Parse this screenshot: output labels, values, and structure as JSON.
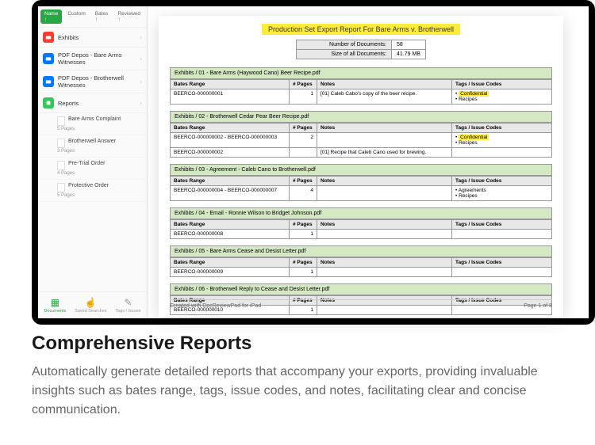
{
  "tabs": {
    "t0": "Name ↑",
    "t1": "Custom",
    "t2": "Bates ↑",
    "t3": "Reviewed ↑"
  },
  "nav": {
    "exhibits": "Exhibits",
    "depos": "PDF Depos - Bare Arms Witnesses",
    "depos2": "PDF Depos - Brotherwell Witnesses",
    "reports": "Reports"
  },
  "subs": {
    "s0": {
      "t": "Bare Arms Complaint",
      "p": "5 Pages"
    },
    "s1": {
      "t": "Brotherwell Answer",
      "p": "3 Pages"
    },
    "s2": {
      "t": "Pre-Trial Order",
      "p": "4 Pages"
    },
    "s3": {
      "t": "Protective Order",
      "p": "5 Pages"
    }
  },
  "btabs": {
    "b0": "Documents",
    "b1": "Saved Searches",
    "b2": "Tags / Issues"
  },
  "report": {
    "title": "Production Set Export Report For Bare Arms v. Brotherwell",
    "meta": {
      "l0": "Number of Documents:",
      "v0": "58",
      "l1": "Size of all Documents:",
      "v1": "41.79 MB"
    },
    "headers": {
      "bates": "Bates Range",
      "pages": "# Pages",
      "notes": "Notes",
      "tags": "Tags / Issue Codes"
    },
    "sections": [
      {
        "head": "Exhibits / 01 - Bare Arms (Haywood Cano) Beer Recipe.pdf",
        "rows": [
          {
            "b": "BEERCO-000000001",
            "p": "1",
            "n": "[01] Caleb Cabo's copy of the beer recipe.",
            "t": [
              "Confidential",
              "Recipes"
            ],
            "hl": true
          }
        ]
      },
      {
        "head": "Exhibits / 02 - Brotherwell Cedar Pear Beer Recipe.pdf",
        "rows": [
          {
            "b": "BEERCO-000000002 - BEERCO-000000003",
            "p": "2",
            "n": "",
            "t": [
              "Confidential",
              "Recipes"
            ],
            "hl": true
          },
          {
            "b": "BEERCO-000000002",
            "p": "",
            "n": "[01] Recipe that Caleb Cano used for brewing.",
            "t": []
          }
        ]
      },
      {
        "head": "Exhibits / 03 - Agreement - Caleb Cano to Brotherwell.pdf",
        "rows": [
          {
            "b": "BEERCO-000000004 - BEERCO-000000007",
            "p": "4",
            "n": "",
            "t": [
              "Agreements",
              "Recipes"
            ]
          }
        ]
      },
      {
        "head": "Exhibits / 04 - Email - Ronnie Wilson to Bridget Johnson.pdf",
        "rows": [
          {
            "b": "BEERCO-000000008",
            "p": "1",
            "n": "",
            "t": []
          }
        ]
      },
      {
        "head": "Exhibits / 05 - Bare Arms Cease and Desist Letter.pdf",
        "rows": [
          {
            "b": "BEERCO-000000009",
            "p": "1",
            "n": "",
            "t": []
          }
        ]
      },
      {
        "head": "Exhibits / 06 - Brotherwell Reply to Cease and Desist Letter.pdf",
        "rows": [
          {
            "b": "BEERCO-000000010",
            "p": "1",
            "n": "",
            "t": []
          }
        ]
      }
    ],
    "footer": {
      "left": "Created with DocReviewPad for iPad",
      "right": "Page 1 of 8"
    }
  },
  "marketing": {
    "h": "Comprehensive Reports",
    "p": "Automatically generate detailed reports that accompany your exports, providing invaluable insights such as bates range, tags, issue codes, and notes, facilitating clear and concise communication."
  }
}
